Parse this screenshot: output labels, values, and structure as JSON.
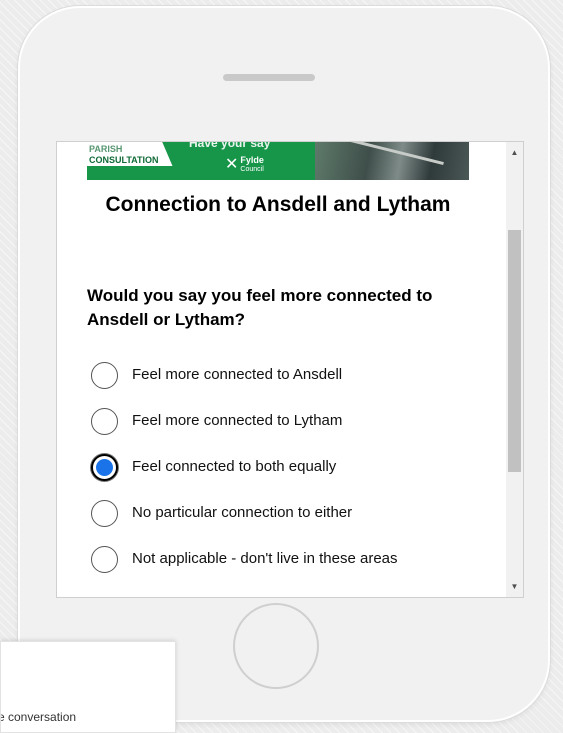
{
  "banner": {
    "label_top": "PARISH",
    "label_bottom": "CONSULTATION",
    "tagline": "Have your say",
    "logo_name": "Fylde",
    "logo_sub": "Council"
  },
  "page": {
    "title": "Connection to Ansdell and Lytham",
    "question": "Would you say you feel more connected to Ansdell or Lytham?"
  },
  "options": [
    {
      "label": "Feel more connected to Ansdell",
      "checked": false
    },
    {
      "label": "Feel more connected to Lytham",
      "checked": false
    },
    {
      "label": "Feel connected to both equally",
      "checked": true
    },
    {
      "label": "No particular connection to either",
      "checked": false
    },
    {
      "label": "Not applicable - don't live in these areas",
      "checked": false
    }
  ],
  "scrollbar": {
    "up_icon": "triangle-up",
    "down_icon": "triangle-down"
  },
  "popup": {
    "text": "e conversation"
  },
  "colors": {
    "brand_green": "#17964a",
    "radio_selected": "#1a73e8"
  }
}
